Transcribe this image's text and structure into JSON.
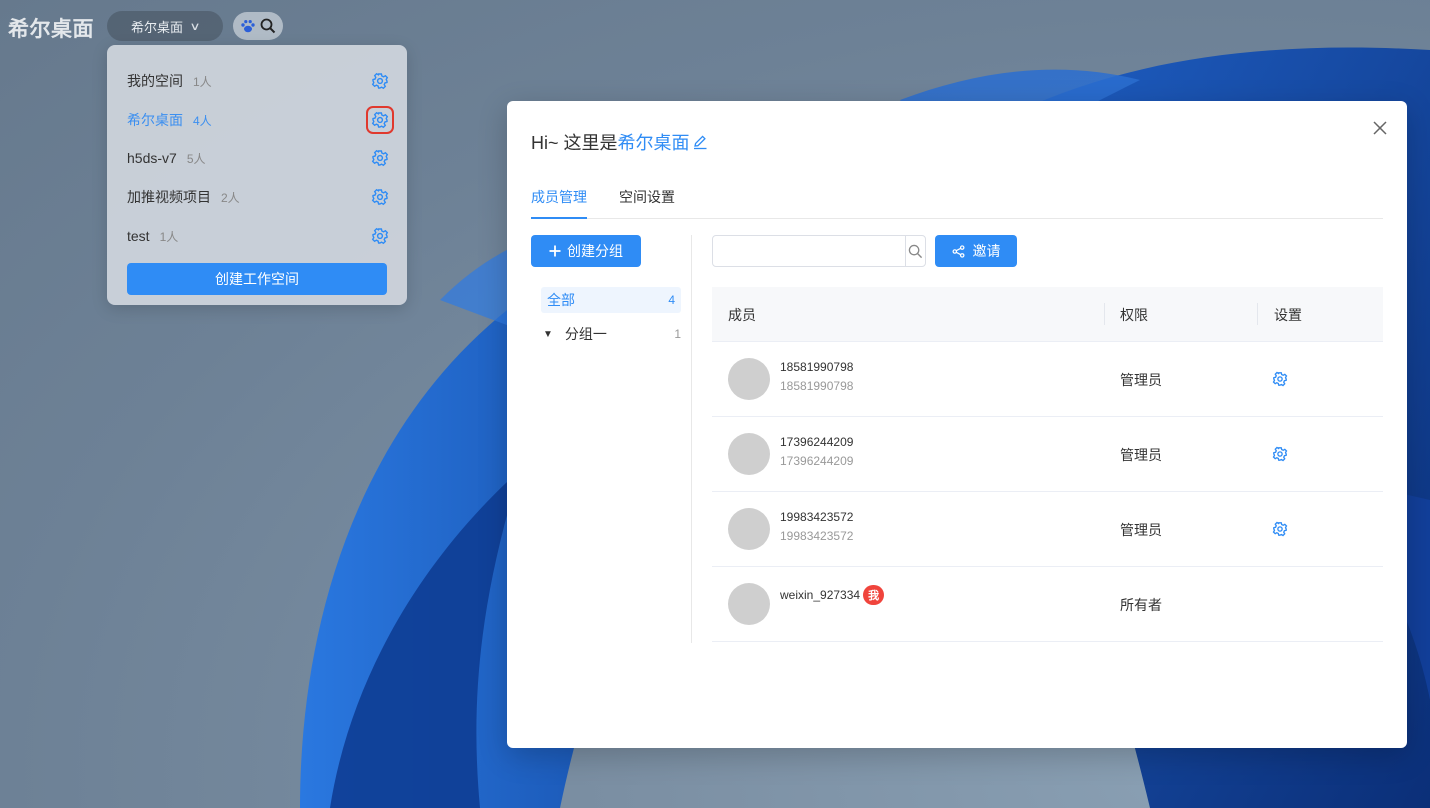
{
  "app": {
    "title": "希尔桌面"
  },
  "topbar": {
    "current_space": "希尔桌面",
    "chevron_icon": "chevron-down-icon",
    "paw_icon": "paw-icon",
    "search_icon": "search-icon"
  },
  "space_menu": {
    "items": [
      {
        "name": "我的空间",
        "count": "1人",
        "active": false
      },
      {
        "name": "希尔桌面",
        "count": "4人",
        "active": true
      },
      {
        "name": "h5ds-v7",
        "count": "5人",
        "active": false
      },
      {
        "name": "加推视频项目",
        "count": "2人",
        "active": false
      },
      {
        "name": "test",
        "count": "1人",
        "active": false
      }
    ],
    "create_label": "创建工作空间"
  },
  "dialog": {
    "greeting": "Hi~ 这里是",
    "space_name": "希尔桌面",
    "tabs": [
      "成员管理",
      "空间设置"
    ],
    "active_tab": 0,
    "create_group_label": "创建分组",
    "groups": [
      {
        "name": "全部",
        "count": "4"
      },
      {
        "name": "分组一",
        "count": "1"
      }
    ],
    "search": {
      "value": "",
      "placeholder": ""
    },
    "invite_label": "邀请",
    "table": {
      "headers": [
        "成员",
        "权限",
        "设置"
      ],
      "rows": [
        {
          "name": "18581990798",
          "sub": "18581990798",
          "role": "管理员",
          "has_settings": true,
          "is_me": false
        },
        {
          "name": "17396244209",
          "sub": "17396244209",
          "role": "管理员",
          "has_settings": true,
          "is_me": false
        },
        {
          "name": "19983423572",
          "sub": "19983423572",
          "role": "管理员",
          "has_settings": true,
          "is_me": false
        },
        {
          "name": "weixin_927334",
          "sub": "",
          "role": "所有者",
          "has_settings": false,
          "is_me": true,
          "badge": "我"
        }
      ]
    }
  },
  "colors": {
    "accent": "#2f8cf5",
    "badge": "#f0443c",
    "highlight_box": "#e0392e"
  }
}
